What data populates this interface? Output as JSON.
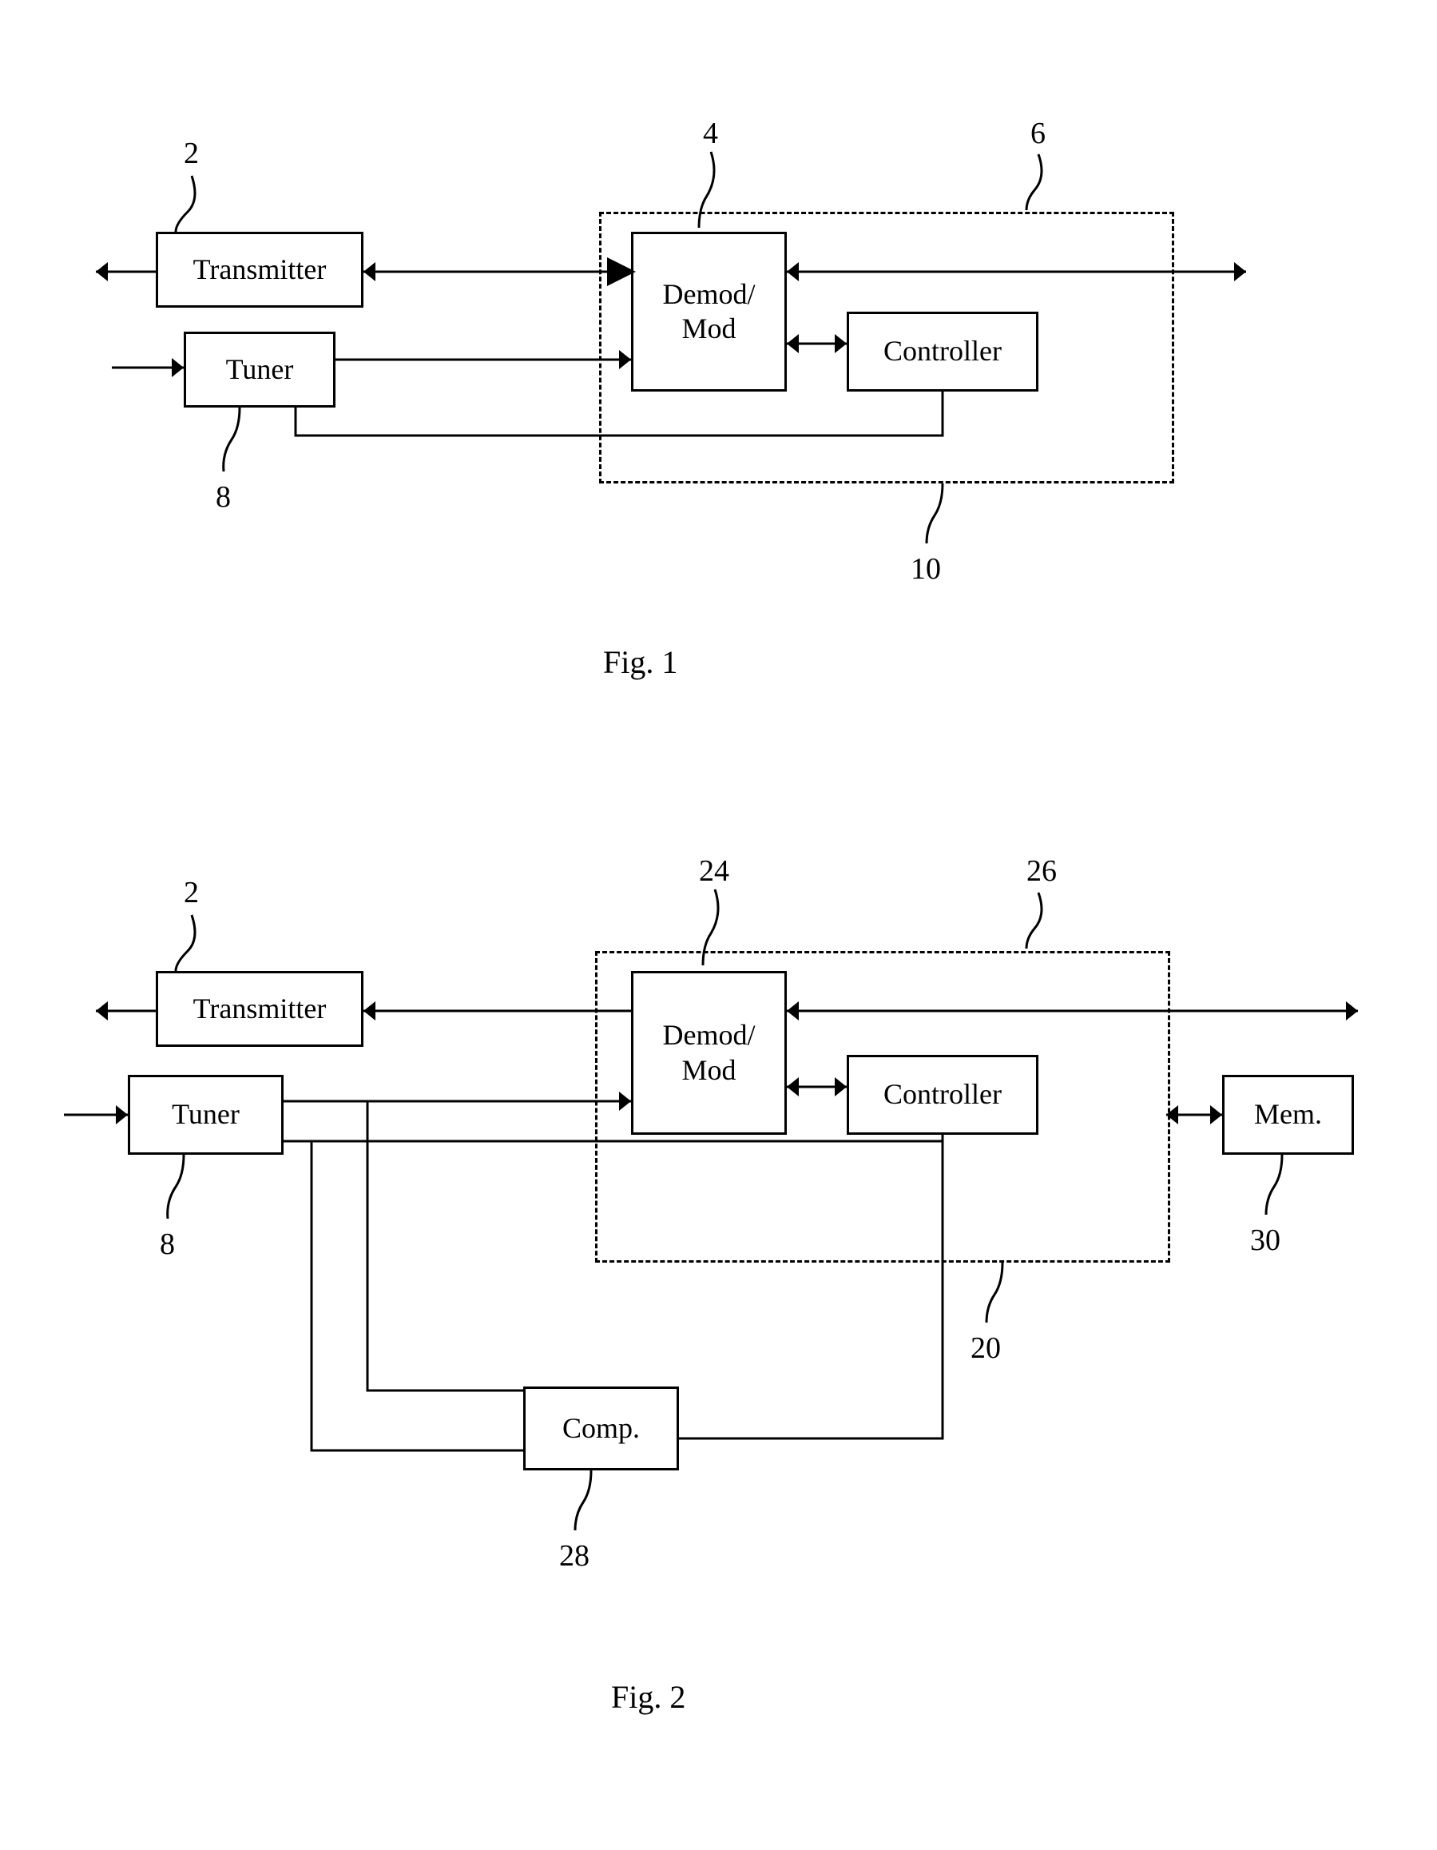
{
  "fig1": {
    "caption": "Fig. 1",
    "ref_transmitter": "2",
    "ref_demod": "4",
    "ref_dashed": "6",
    "ref_tuner": "8",
    "ref_controller": "10",
    "blocks": {
      "transmitter": "Transmitter",
      "tuner": "Tuner",
      "demod": "Demod/\nMod",
      "controller": "Controller"
    }
  },
  "fig2": {
    "caption": "Fig. 2",
    "ref_transmitter": "2",
    "ref_demod": "24",
    "ref_dashed": "26",
    "ref_tuner": "8",
    "ref_controller": "20",
    "ref_mem": "30",
    "ref_comp": "28",
    "blocks": {
      "transmitter": "Transmitter",
      "tuner": "Tuner",
      "demod": "Demod/\nMod",
      "controller": "Controller",
      "mem": "Mem.",
      "comp": "Comp."
    }
  }
}
